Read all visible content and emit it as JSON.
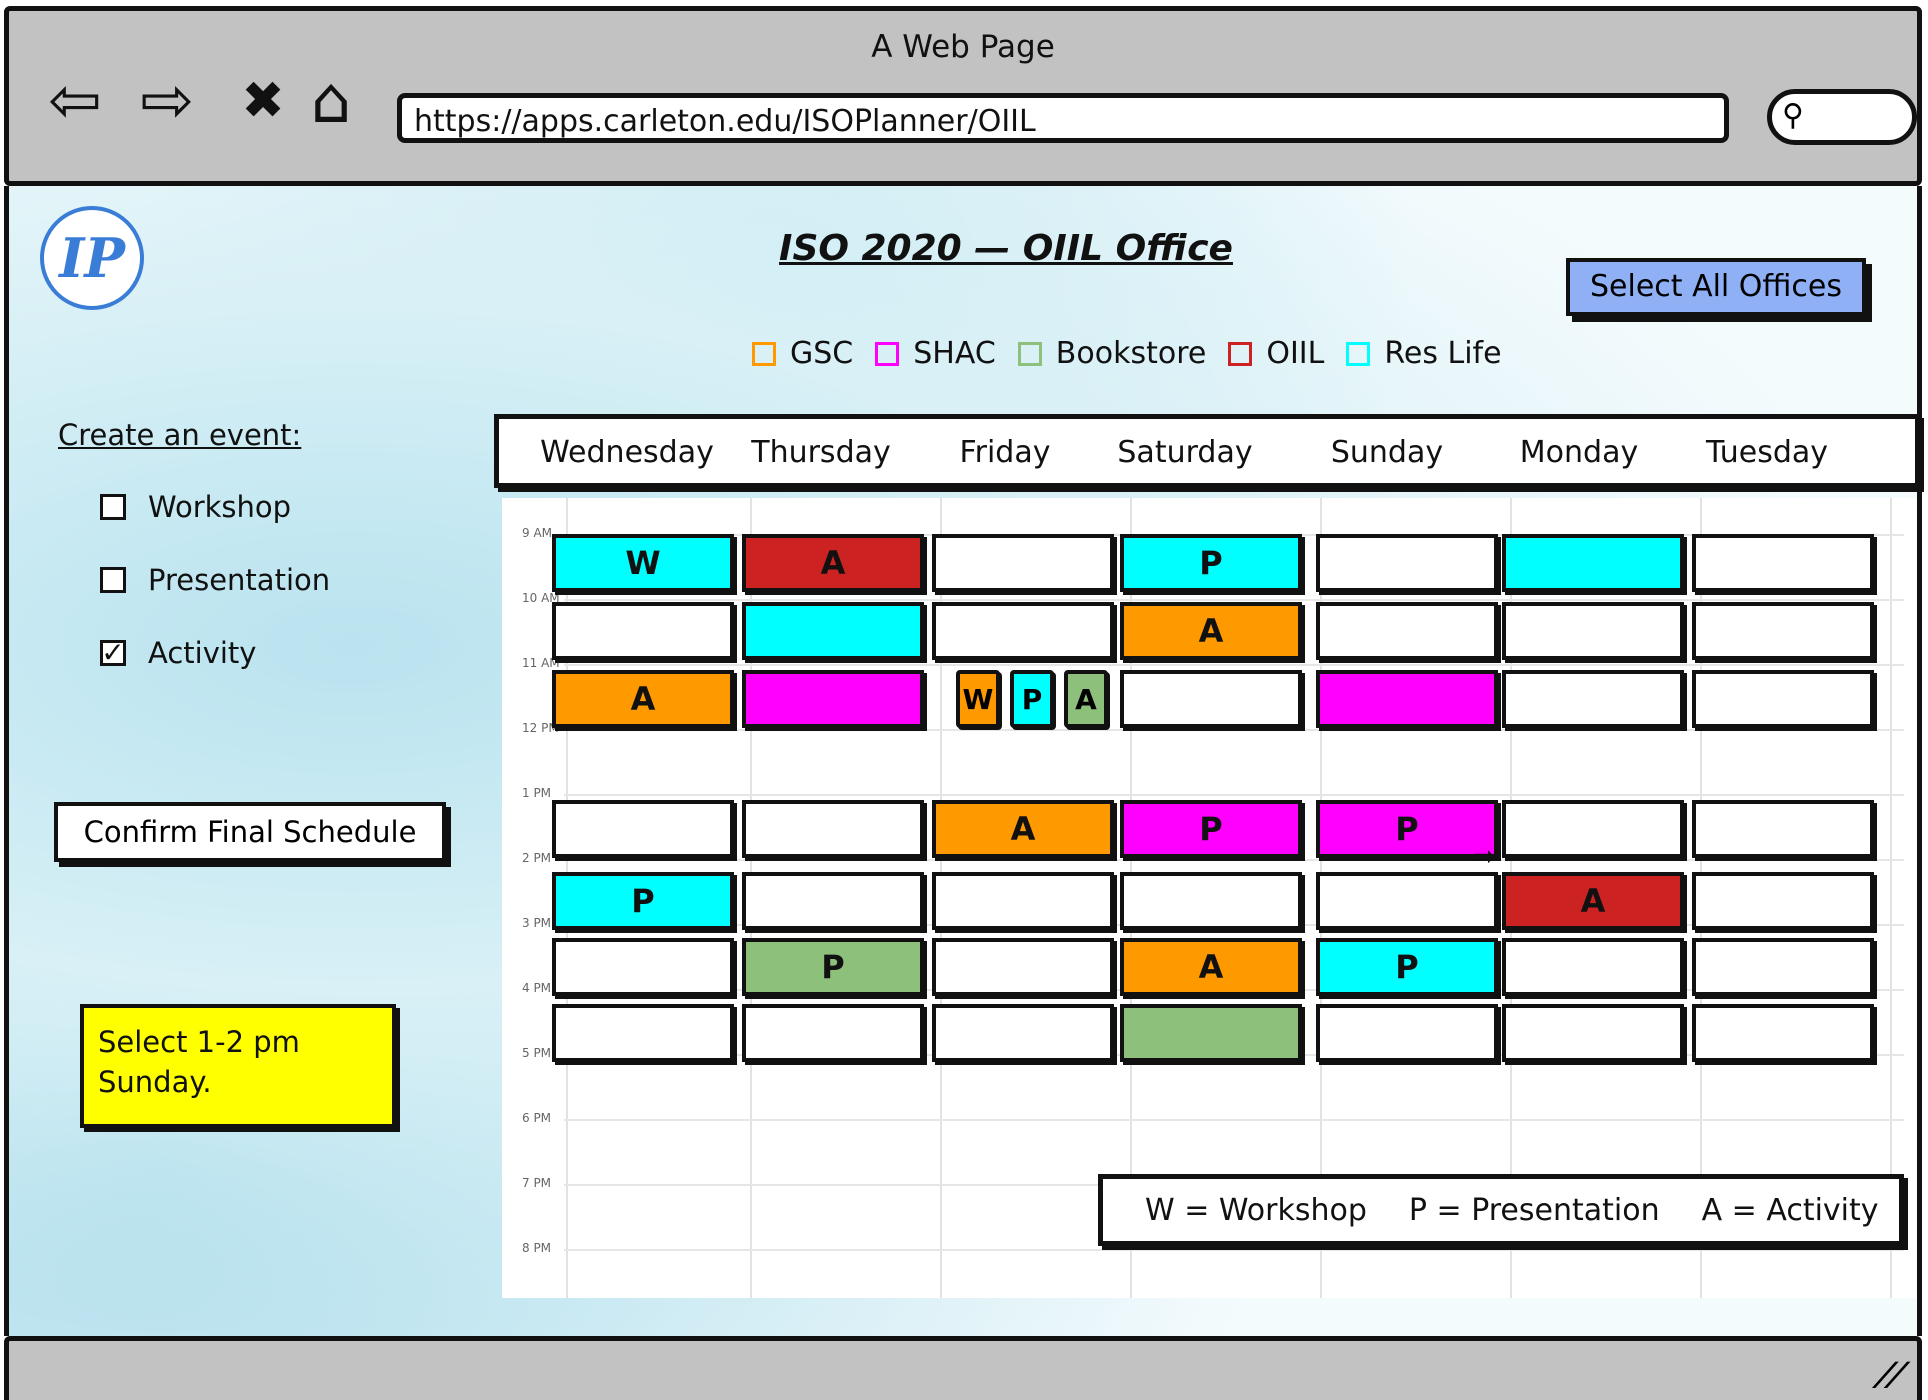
{
  "window": {
    "title": "A Web Page"
  },
  "browser": {
    "url": "https://apps.carleton.edu/ISOPlanner/OIIL",
    "nav_icons": [
      "back-arrow-icon",
      "forward-arrow-icon",
      "close-icon",
      "home-icon"
    ],
    "search_icon": "search-icon"
  },
  "logo": {
    "text": "IP"
  },
  "page": {
    "title": "ISO 2020 — OIIL Office",
    "select_all_label": "Select All Offices"
  },
  "offices": [
    {
      "name": "GSC",
      "color": "#ff9900"
    },
    {
      "name": "SHAC",
      "color": "#ff00ff"
    },
    {
      "name": "Bookstore",
      "color": "#8dc07a"
    },
    {
      "name": "OIIL",
      "color": "#cc2222"
    },
    {
      "name": "Res Life",
      "color": "#00ffff"
    }
  ],
  "sidebar": {
    "create_label": "Create an event:",
    "event_types": [
      {
        "label": "Workshop",
        "checked": false
      },
      {
        "label": "Presentation",
        "checked": false
      },
      {
        "label": "Activity",
        "checked": true
      }
    ],
    "confirm_label": "Confirm Final Schedule",
    "note": [
      "Select 1-2 pm",
      "Sunday."
    ]
  },
  "days": [
    "Wednesday",
    "Thursday",
    "Friday",
    "Saturday",
    "Sunday",
    "Monday",
    "Tuesday"
  ],
  "times": [
    "9 AM",
    "10 AM",
    "11 AM",
    "12 PM",
    "1 PM",
    "2 PM",
    "3 PM",
    "4 PM",
    "5 PM",
    "6 PM",
    "7 PM",
    "8 PM"
  ],
  "schedule": [
    {
      "time": "9 AM",
      "cells": [
        {
          "label": "W",
          "color": "#00ffff"
        },
        {
          "label": "A",
          "color": "#cc2222"
        },
        {
          "label": "",
          "color": "#ffffff"
        },
        {
          "label": "P",
          "color": "#00ffff"
        },
        {
          "label": "",
          "color": "#ffffff"
        },
        {
          "label": "",
          "color": "#00ffff"
        },
        {
          "label": "",
          "color": "#ffffff"
        }
      ]
    },
    {
      "time": "10 AM",
      "cells": [
        {
          "label": "",
          "color": "#ffffff"
        },
        {
          "label": "",
          "color": "#00ffff"
        },
        {
          "label": "",
          "color": "#ffffff"
        },
        {
          "label": "A",
          "color": "#ff9900"
        },
        {
          "label": "",
          "color": "#ffffff"
        },
        {
          "label": "",
          "color": "#ffffff"
        },
        {
          "label": "",
          "color": "#ffffff"
        }
      ]
    },
    {
      "time": "11 AM",
      "cells": [
        {
          "label": "A",
          "color": "#ff9900"
        },
        {
          "label": "",
          "color": "#ff00ff"
        },
        {
          "split": [
            {
              "label": "W",
              "color": "#ff9900"
            },
            {
              "label": "P",
              "color": "#00ffff"
            },
            {
              "label": "A",
              "color": "#8dc07a"
            }
          ]
        },
        {
          "label": "",
          "color": "#ffffff"
        },
        {
          "label": "",
          "color": "#ff00ff"
        },
        {
          "label": "",
          "color": "#ffffff"
        },
        {
          "label": "",
          "color": "#ffffff"
        }
      ]
    },
    {
      "time": "1 PM",
      "cells": [
        {
          "label": "",
          "color": "#ffffff"
        },
        {
          "label": "",
          "color": "#ffffff"
        },
        {
          "label": "A",
          "color": "#ff9900"
        },
        {
          "label": "P",
          "color": "#ff00ff"
        },
        {
          "label": "P",
          "color": "#ff00ff"
        },
        {
          "label": "",
          "color": "#ffffff"
        },
        {
          "label": "",
          "color": "#ffffff"
        }
      ]
    },
    {
      "time": "2 PM",
      "cells": [
        {
          "label": "P",
          "color": "#00ffff"
        },
        {
          "label": "",
          "color": "#ffffff"
        },
        {
          "label": "",
          "color": "#ffffff"
        },
        {
          "label": "",
          "color": "#ffffff"
        },
        {
          "label": "",
          "color": "#ffffff"
        },
        {
          "label": "A",
          "color": "#cc2222"
        },
        {
          "label": "",
          "color": "#ffffff"
        }
      ]
    },
    {
      "time": "3 PM",
      "cells": [
        {
          "label": "",
          "color": "#ffffff"
        },
        {
          "label": "P",
          "color": "#8dc07a"
        },
        {
          "label": "",
          "color": "#ffffff"
        },
        {
          "label": "A",
          "color": "#ff9900"
        },
        {
          "label": "P",
          "color": "#00ffff"
        },
        {
          "label": "",
          "color": "#ffffff"
        },
        {
          "label": "",
          "color": "#ffffff"
        }
      ]
    },
    {
      "time": "4 PM",
      "cells": [
        {
          "label": "",
          "color": "#ffffff"
        },
        {
          "label": "",
          "color": "#ffffff"
        },
        {
          "label": "",
          "color": "#ffffff"
        },
        {
          "label": "",
          "color": "#8dc07a"
        },
        {
          "label": "",
          "color": "#ffffff"
        },
        {
          "label": "",
          "color": "#ffffff"
        },
        {
          "label": "",
          "color": "#ffffff"
        }
      ]
    }
  ],
  "key": [
    "W = Workshop",
    "P = Presentation",
    "A = Activity"
  ]
}
